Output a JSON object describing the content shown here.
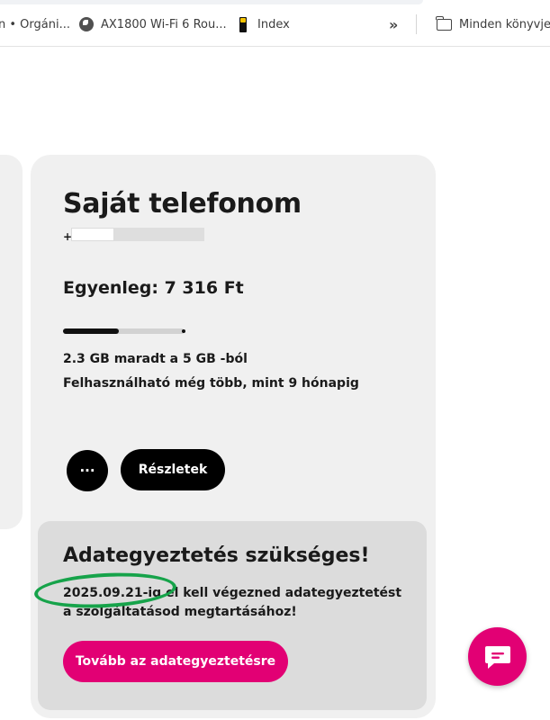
{
  "bookmarks": {
    "items": [
      {
        "label": "n • Orgáni...",
        "icon": "none"
      },
      {
        "label": "AX1800 Wi-Fi 6 Rou...",
        "icon": "globe-icon"
      },
      {
        "label": "Index",
        "icon": "index-logo-icon"
      }
    ],
    "overflow_label": "»",
    "folder_label": "Minden könyvjel"
  },
  "card": {
    "title": "Saját telefonom",
    "phone_prefix": "+",
    "balance": "Egyenleg: 7 316 Ft",
    "data_usage_fraction": 0.46,
    "remaining": "2.3 GB maradt a 5 GB -ból",
    "validity": "Felhasználható még több, mint 9 hónapig",
    "more_label": "···",
    "details_label": "Részletek"
  },
  "alert": {
    "title": "Adategyeztetés szükséges!",
    "text": "2025.09.21-ig el kell végezned adategyeztetést a szolgáltatásod megtartásához!",
    "cta_label": "Tovább az adategyeztetésre",
    "highlight_color": "#16a34a"
  },
  "colors": {
    "brand": "#e20074",
    "card_bg": "#f0f0f0",
    "alert_bg": "#dcdcdc"
  }
}
